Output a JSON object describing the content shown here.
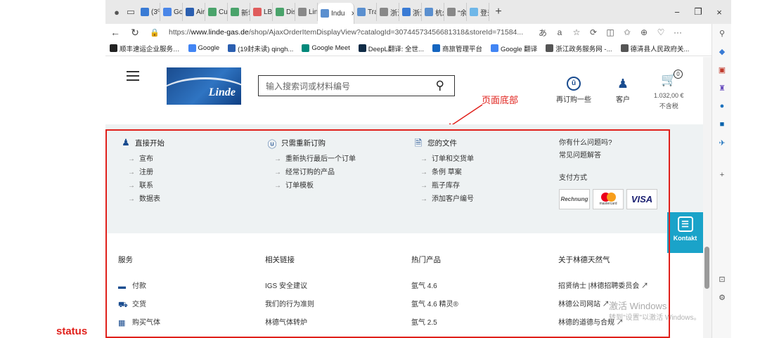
{
  "tabs": [
    {
      "label": "(3⁰",
      "color": "#3a7bd5"
    },
    {
      "label": "Goo(",
      "color": "#4a86e8"
    },
    {
      "label": "Airg",
      "color": "#2b5fb0"
    },
    {
      "label": "Cust",
      "color": "#4aa36b"
    },
    {
      "label": "新增",
      "color": "#4aa36b"
    },
    {
      "label": "LBU",
      "color": "#e05c5c"
    },
    {
      "label": "Distr",
      "color": "#4aa36b"
    },
    {
      "label": "Lind",
      "color": "#888888"
    },
    {
      "label": "Indu",
      "color": "#5a8fcf"
    },
    {
      "label": "Tran",
      "color": "#5a8fcf"
    },
    {
      "label": "浙江",
      "color": "#888888"
    },
    {
      "label": "浙江",
      "color": "#3a7bd5"
    },
    {
      "label": "杭州",
      "color": "#5a8fcf"
    },
    {
      "label": "\"余…",
      "color": "#888888"
    },
    {
      "label": "登录",
      "color": "#6fb7e8"
    }
  ],
  "active_tab_close": "×",
  "new_tab": "+",
  "window_controls": {
    "minimize": "−",
    "restore": "❐",
    "close": "×"
  },
  "address": {
    "url_prefix": "https://",
    "url_domain": "www.linde-gas.de",
    "url_rest": "/shop/AjaxOrderItemDisplayView?catalogId=30744573456681318&storeId=71584...",
    "aa": "a",
    "more": "···"
  },
  "bookmarks": [
    {
      "label": "顺丰速运企业服务…",
      "color": "#222222"
    },
    {
      "label": "Google",
      "color": "#4285f4"
    },
    {
      "label": "(19封未读) qingh...",
      "color": "#2b5fb0"
    },
    {
      "label": "Google Meet",
      "color": "#00897b"
    },
    {
      "label": "DeepL翻译: 全世...",
      "color": "#0f2b46"
    },
    {
      "label": "商旅管理平台",
      "color": "#1565c0"
    },
    {
      "label": "Google 翻译",
      "color": "#4285f4"
    },
    {
      "label": "浙江政务服务网 -...",
      "color": "#555555"
    },
    {
      "label": "德清县人民政府关...",
      "color": "#555555"
    }
  ],
  "header": {
    "logo_text": "Linde",
    "search_placeholder": "输入搜索词或材料编号",
    "reorder_label": "再订购一些",
    "customer_label": "客户",
    "cart_count": "0",
    "cart_price": "1.032,00 €",
    "cart_tax": "不含税"
  },
  "annotation": {
    "label": "页面底部",
    "color": "#e0201b"
  },
  "footer_top": {
    "col1": {
      "title": "直接开始",
      "links": [
        "宣布",
        "注册",
        "联系",
        "数据表"
      ]
    },
    "col2": {
      "title": "只需重新订购",
      "links": [
        "重新执行最后一个订单",
        "经常订购的产品",
        "订单模板"
      ]
    },
    "col3": {
      "title": "您的文件",
      "links": [
        "订单和交货单",
        "条例 草案",
        "瓶子库存",
        "添加客户编号"
      ]
    },
    "col4": {
      "title": "你有什么问题吗?",
      "faq": "常见问题解答",
      "pay_title": "支付方式",
      "pay": [
        "Rechnung",
        "mastercard",
        "VISA"
      ]
    }
  },
  "kontakt": "Kontakt",
  "footer_bottom": {
    "col1": {
      "title": "服务",
      "items": [
        "付款",
        "交货",
        "购买气体"
      ]
    },
    "col2": {
      "title": "相关链接",
      "items": [
        "IGS 安全建议",
        "我们的行为准则",
        "林德气体转炉"
      ]
    },
    "col3": {
      "title": "热门产品",
      "items": [
        "氩气 4.6",
        "氩气 4.6 精灵®",
        "氩气 2.5"
      ]
    },
    "col4": {
      "title": "关于林德天然气",
      "items": [
        "招贤纳士 |林德招聘委员会 ↗",
        "林德公司网站 ↗",
        "林德的道德与合规 ↗"
      ]
    }
  },
  "watermark": {
    "line1": "激活 Windows",
    "line2": "转到\"设置\"以激活 Windows。"
  },
  "status_label": "status"
}
